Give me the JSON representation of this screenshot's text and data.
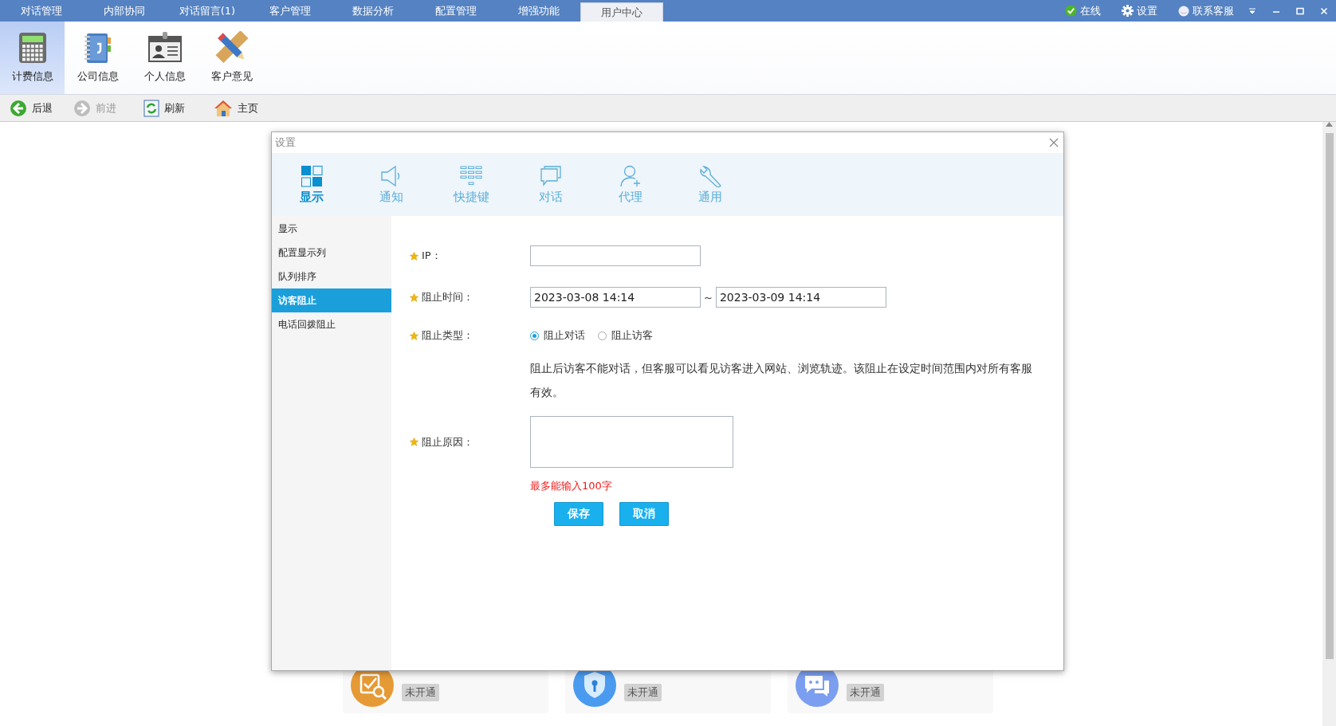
{
  "top_tabs": [
    {
      "label": "对话管理",
      "selected": false
    },
    {
      "label": "内部协同",
      "selected": false
    },
    {
      "label": "对话留言(1)",
      "selected": false
    },
    {
      "label": "客户管理",
      "selected": false
    },
    {
      "label": "数据分析",
      "selected": false
    },
    {
      "label": "配置管理",
      "selected": false
    },
    {
      "label": "增强功能",
      "selected": false
    },
    {
      "label": "用户中心",
      "selected": true
    }
  ],
  "status": {
    "online": "在线",
    "settings": "设置",
    "support": "联系客服"
  },
  "ribbon": [
    {
      "label": "计费信息",
      "selected": true,
      "kind": "calculator"
    },
    {
      "label": "公司信息",
      "selected": false,
      "kind": "notebook"
    },
    {
      "label": "个人信息",
      "selected": false,
      "kind": "idcard"
    },
    {
      "label": "客户意见",
      "selected": false,
      "kind": "pencil"
    }
  ],
  "nav": [
    {
      "label": "后退",
      "disabled": false,
      "kind": "back"
    },
    {
      "label": "前进",
      "disabled": true,
      "kind": "forward"
    },
    {
      "label": "刷新",
      "disabled": false,
      "kind": "refresh"
    },
    {
      "label": "主页",
      "disabled": false,
      "kind": "home"
    }
  ],
  "dialog": {
    "title": "设置",
    "tabs": [
      {
        "label": "显示",
        "selected": true,
        "kind": "grid"
      },
      {
        "label": "通知",
        "selected": false,
        "kind": "speaker"
      },
      {
        "label": "快捷键",
        "selected": false,
        "kind": "keys"
      },
      {
        "label": "对话",
        "selected": false,
        "kind": "chat"
      },
      {
        "label": "代理",
        "selected": false,
        "kind": "user"
      },
      {
        "label": "通用",
        "selected": false,
        "kind": "wrench"
      }
    ],
    "sidebar": [
      {
        "label": "显示",
        "selected": false
      },
      {
        "label": "配置显示列",
        "selected": false
      },
      {
        "label": "队列排序",
        "selected": false
      },
      {
        "label": "访客阻止",
        "selected": true
      },
      {
        "label": "电话回拨阻止",
        "selected": false
      }
    ],
    "form": {
      "ip_label": "IP：",
      "time_label": "阻止时间：",
      "start_time": "2023-03-08 14:14",
      "separator": "~",
      "end_time": "2023-03-09 14:14",
      "type_label": "阻止类型：",
      "type_options": [
        {
          "label": "阻止对话",
          "selected": true
        },
        {
          "label": "阻止访客",
          "selected": false
        }
      ],
      "description": "阻止后访客不能对话，但客服可以看见访客进入网站、浏览轨迹。该阻止在设定时间范围内对所有客服有效。",
      "reason_label": "阻止原因：",
      "limit_note": "最多能输入100字",
      "buttons": [
        "保存",
        "取消"
      ]
    }
  },
  "services": [
    {
      "status": "未开通",
      "kind": "health"
    },
    {
      "status": "未开通",
      "kind": "shield"
    },
    {
      "status": "未开通",
      "kind": "im"
    }
  ]
}
